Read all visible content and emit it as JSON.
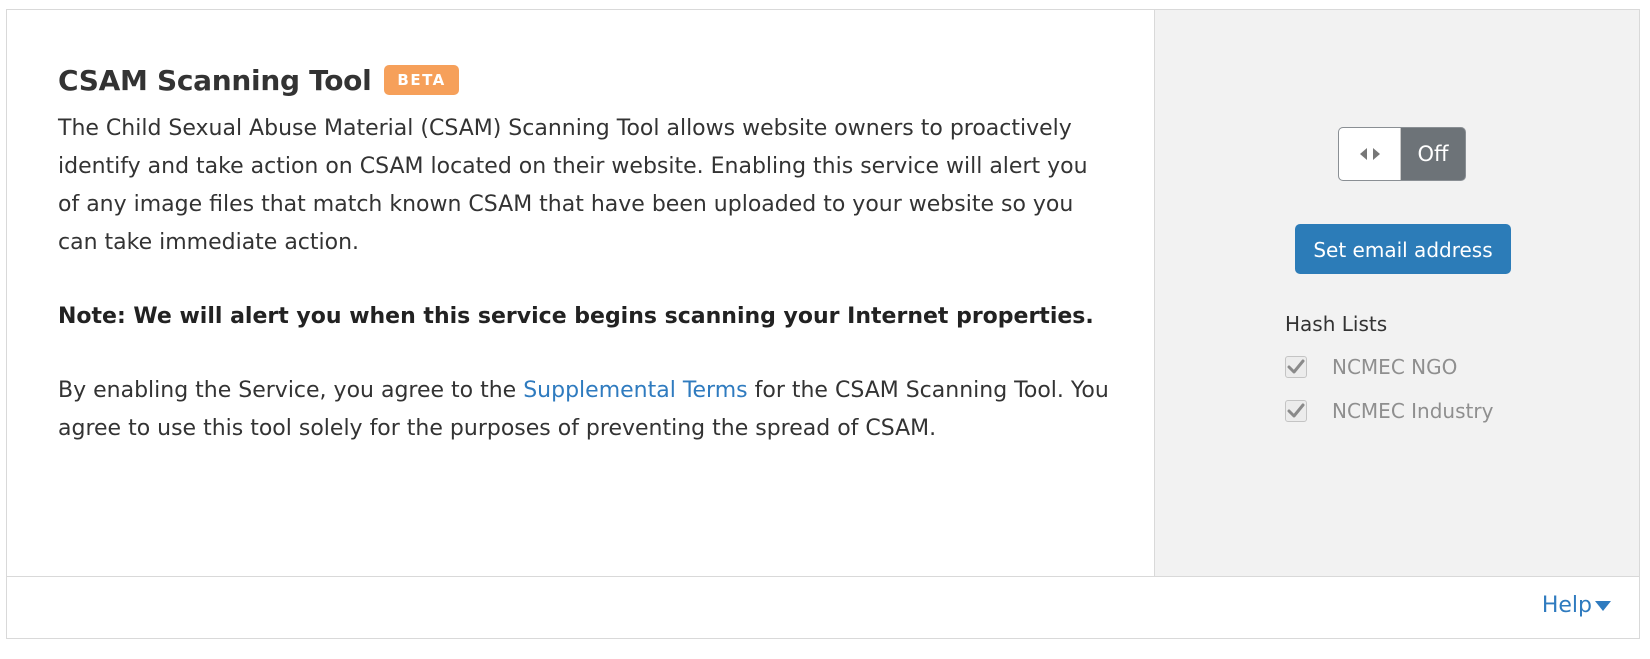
{
  "main": {
    "title": "CSAM Scanning Tool",
    "badge": "BETA",
    "description": "The Child Sexual Abuse Material (CSAM) Scanning Tool allows website owners to proactively identify and take action on CSAM located on their website. Enabling this service will alert you of any image files that match known CSAM that have been uploaded to your website so you can take immediate action.",
    "note": "Note: We will alert you when this service begins scanning your Internet properties.",
    "terms_before": "By enabling the Service, you agree to the ",
    "terms_link": "Supplemental Terms",
    "terms_after": " for the CSAM Scanning Tool. You agree to use this tool solely for the purposes of preventing the spread of CSAM."
  },
  "side": {
    "toggle_state": "Off",
    "email_button": "Set email address",
    "hash_lists_title": "Hash Lists",
    "hash_lists": [
      {
        "label": "NCMEC NGO",
        "checked": true
      },
      {
        "label": "NCMEC Industry",
        "checked": true
      }
    ]
  },
  "footer": {
    "help_label": "Help"
  },
  "colors": {
    "badge": "#f6a05a",
    "button": "#2c7cb8",
    "link": "#2f7bbf",
    "toggle_off": "#6d7378"
  },
  "icons": {
    "toggle_knob": "arrows-left-right-icon",
    "checkbox": "checkmark-icon",
    "help_caret": "caret-down-icon"
  }
}
